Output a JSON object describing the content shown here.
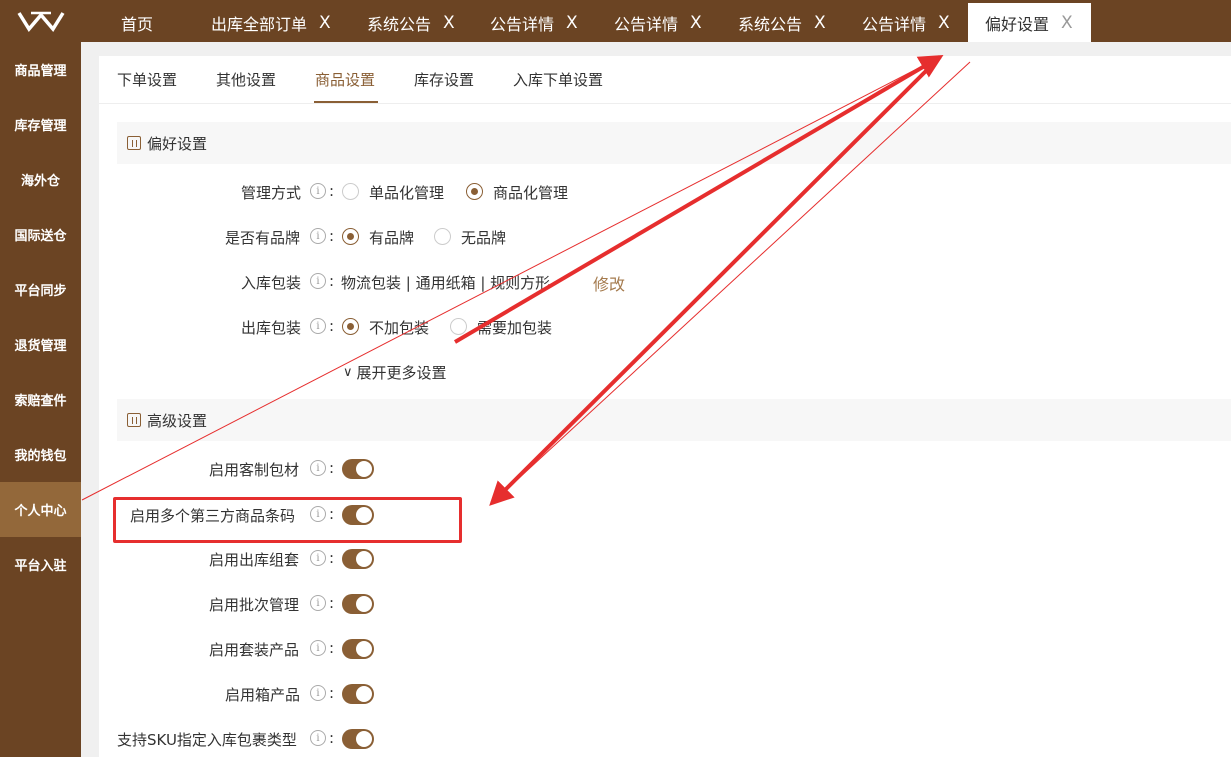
{
  "topbar": {
    "tabs": [
      {
        "label": "首页",
        "closable": false
      },
      {
        "label": "出库全部订单",
        "closable": true
      },
      {
        "label": "系统公告",
        "closable": true
      },
      {
        "label": "公告详情",
        "closable": true
      },
      {
        "label": "公告详情",
        "closable": true
      },
      {
        "label": "系统公告",
        "closable": true
      },
      {
        "label": "公告详情",
        "closable": true
      },
      {
        "label": "偏好设置",
        "closable": true,
        "active": true
      }
    ],
    "close_glyph": "X"
  },
  "sidebar": {
    "items": [
      {
        "label": "商品管理"
      },
      {
        "label": "库存管理"
      },
      {
        "label": "海外仓"
      },
      {
        "label": "国际送仓"
      },
      {
        "label": "平台同步"
      },
      {
        "label": "退货管理"
      },
      {
        "label": "索赔查件"
      },
      {
        "label": "我的钱包"
      },
      {
        "label": "个人中心",
        "active": true
      },
      {
        "label": "平台入驻"
      }
    ]
  },
  "subtabs": [
    {
      "label": "下单设置"
    },
    {
      "label": "其他设置"
    },
    {
      "label": "商品设置",
      "active": true
    },
    {
      "label": "库存设置"
    },
    {
      "label": "入库下单设置"
    }
  ],
  "preference": {
    "title": "偏好设置",
    "manage_mode": {
      "label": "管理方式",
      "options": [
        "单品化管理",
        "商品化管理"
      ],
      "selected": "商品化管理"
    },
    "has_brand": {
      "label": "是否有品牌",
      "options": [
        "有品牌",
        "无品牌"
      ],
      "selected": "有品牌"
    },
    "inbound_pack": {
      "label": "入库包装",
      "values": "物流包装  |  通用纸箱  |  规则方形",
      "modify": "修改"
    },
    "outbound_pack": {
      "label": "出库包装",
      "options": [
        "不加包装",
        "需要加包装"
      ],
      "selected": "不加包装"
    },
    "expand": "展开更多设置"
  },
  "advanced": {
    "title": "高级设置",
    "items": [
      {
        "label": "启用客制包材",
        "enabled": true
      },
      {
        "label": "启用多个第三方商品条码",
        "enabled": true
      },
      {
        "label": "启用出库组套",
        "enabled": true
      },
      {
        "label": "启用批次管理",
        "enabled": true
      },
      {
        "label": "启用套装产品",
        "enabled": true
      },
      {
        "label": "启用箱产品",
        "enabled": true
      },
      {
        "label": "支持SKU指定入库包裹类型",
        "enabled": true
      }
    ]
  },
  "info_glyph": "i",
  "colon": ":",
  "colors": {
    "brand": "#6b4423",
    "accent": "#8a5f35",
    "annotation": "#e62e2e"
  }
}
